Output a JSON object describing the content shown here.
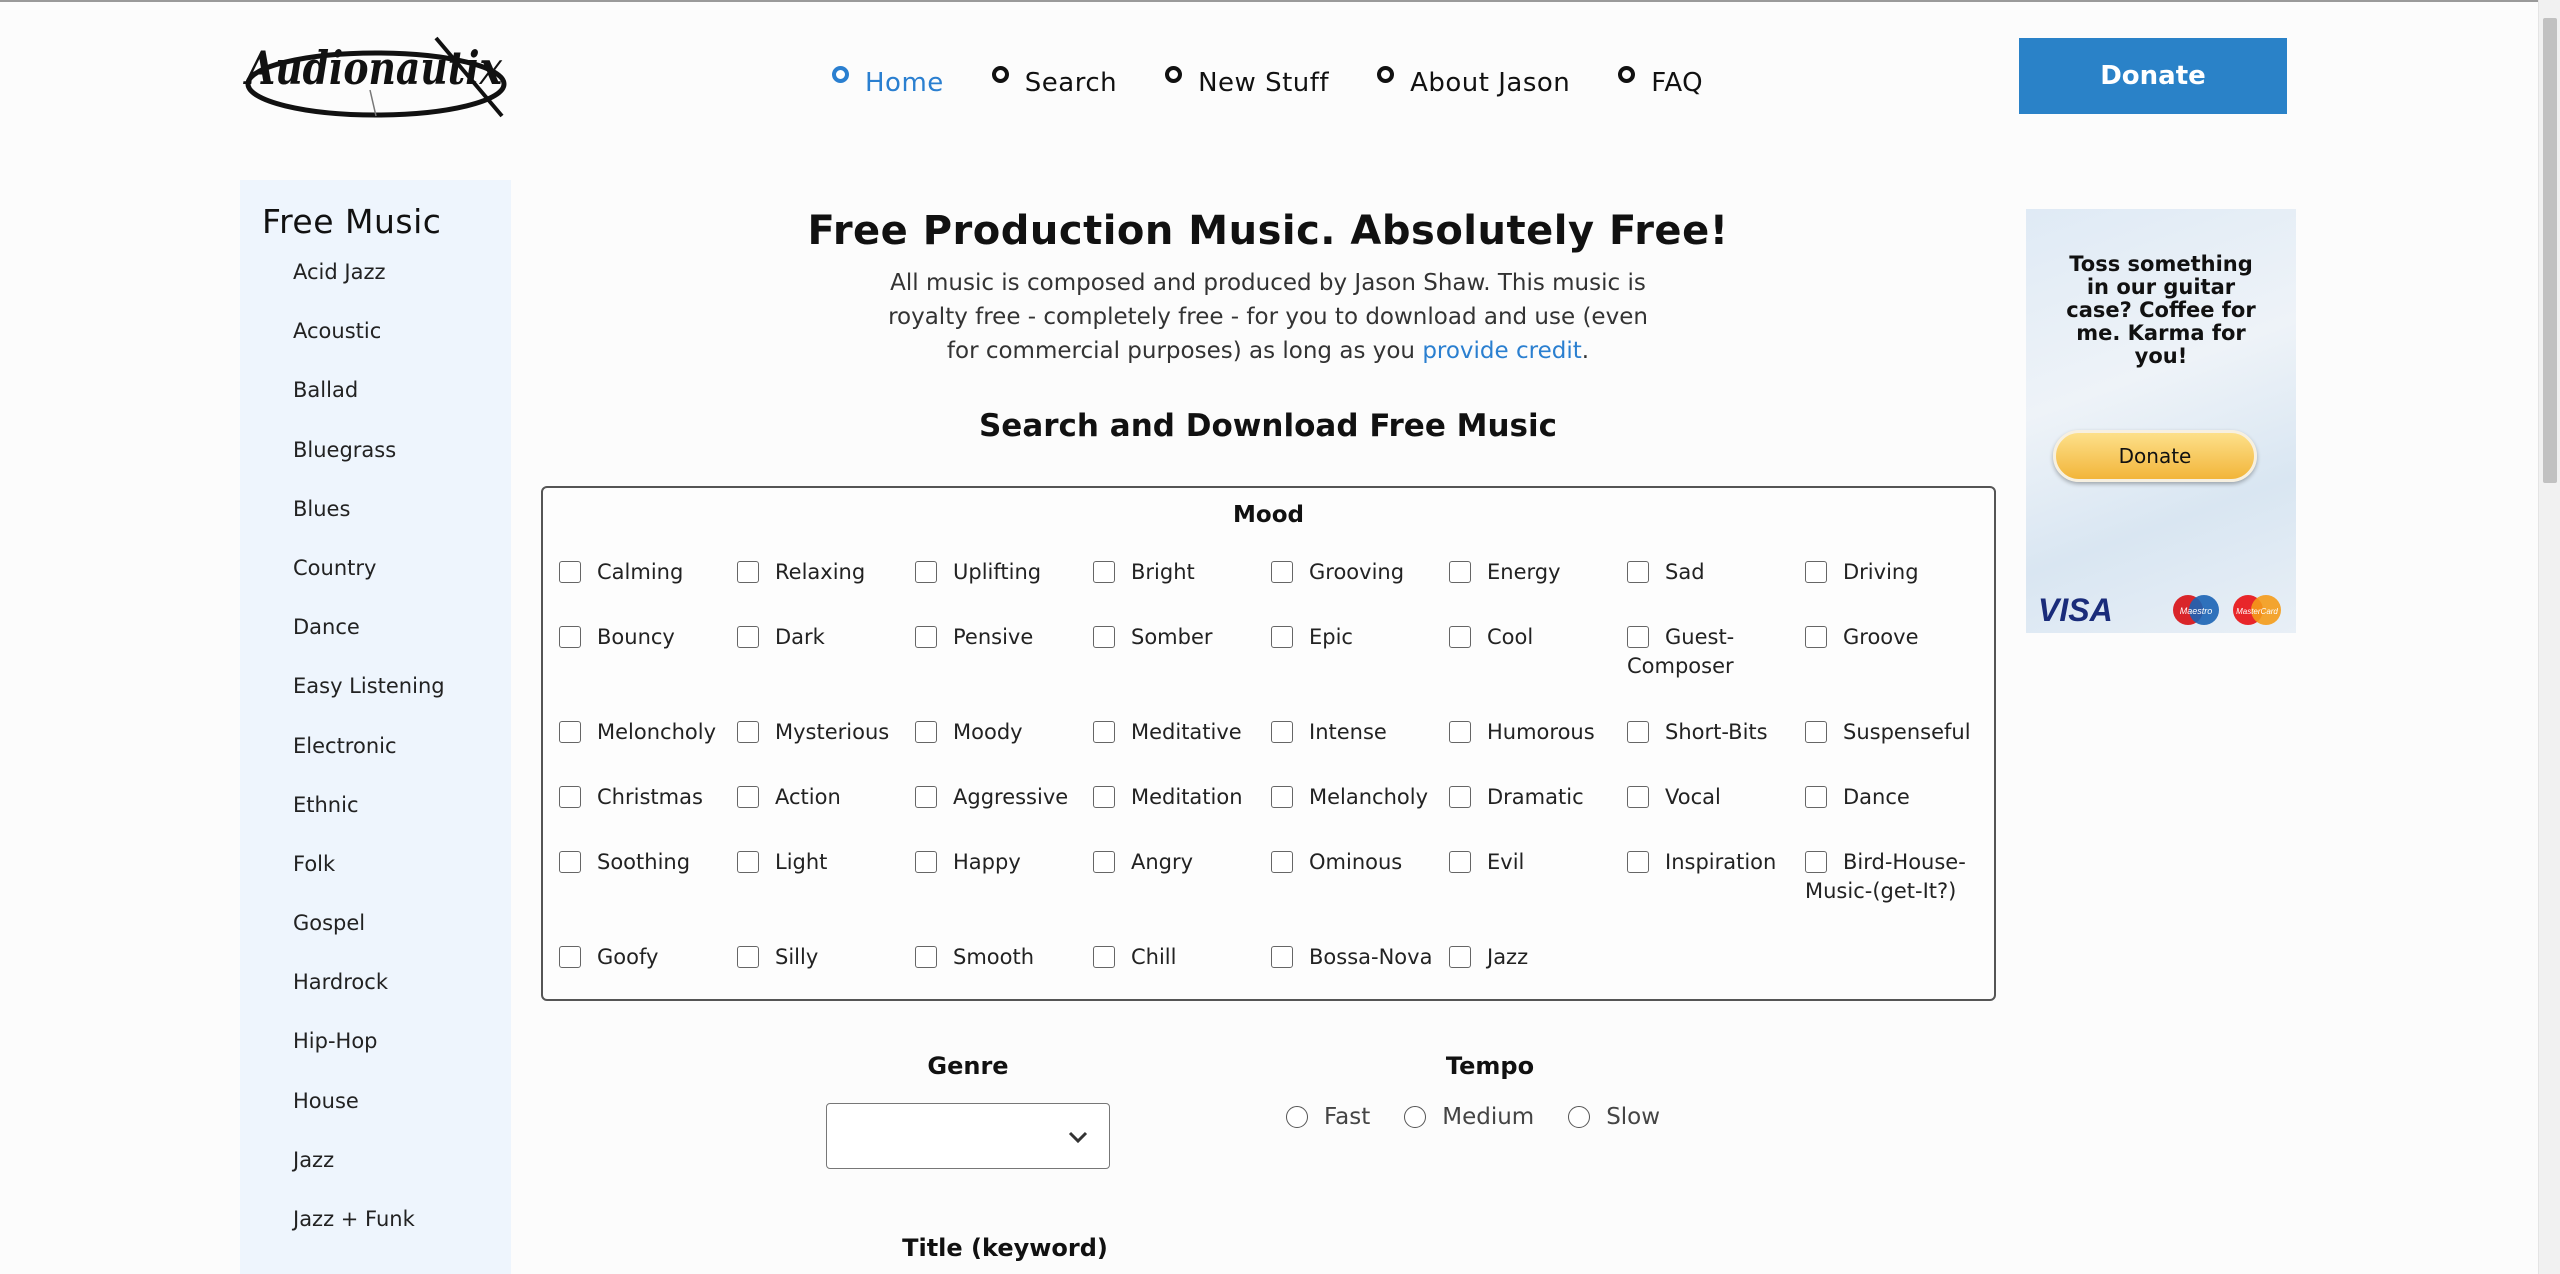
{
  "header": {
    "logo_text": "Audionautix",
    "nav": [
      {
        "label": "Home",
        "active": true
      },
      {
        "label": "Search",
        "active": false
      },
      {
        "label": "New Stuff",
        "active": false
      },
      {
        "label": "About Jason",
        "active": false
      },
      {
        "label": "FAQ",
        "active": false
      }
    ],
    "donate_label": "Donate"
  },
  "sidebar": {
    "title": "Free Music",
    "items": [
      "Acid Jazz",
      "Acoustic",
      "Ballad",
      "Bluegrass",
      "Blues",
      "Country",
      "Dance",
      "Easy Listening",
      "Electronic",
      "Ethnic",
      "Folk",
      "Gospel",
      "Hardrock",
      "Hip-Hop",
      "House",
      "Jazz",
      "Jazz + Funk"
    ]
  },
  "main": {
    "title": "Free Production Music. Absolutely Free!",
    "intro_text": "All music is composed and produced by Jason Shaw. This music is royalty free - completely free - for you to download and use (even for commercial purposes) as long as you",
    "intro_link": "provide credit",
    "intro_end": ".",
    "search_title": "Search and Download Free Music",
    "mood": {
      "legend": "Mood",
      "options": [
        "Calming",
        "Relaxing",
        "Uplifting",
        "Bright",
        "Grooving",
        "Energy",
        "Sad",
        "Driving",
        "Bouncy",
        "Dark",
        "Pensive",
        "Somber",
        "Epic",
        "Cool",
        "Guest-Composer",
        "Groove",
        "Meloncholy",
        "Mysterious",
        "Moody",
        "Meditative",
        "Intense",
        "Humorous",
        "Short-Bits",
        "Suspenseful",
        "Christmas",
        "Action",
        "Aggressive",
        "Meditation",
        "Melancholy",
        "Dramatic",
        "Vocal",
        "Dance",
        "Soothing",
        "Light",
        "Happy",
        "Angry",
        "Ominous",
        "Evil",
        "Inspiration",
        "Bird-House-Music-(get-It?)",
        "Goofy",
        "Silly",
        "Smooth",
        "Chill",
        "Bossa-Nova",
        "Jazz"
      ]
    },
    "genre_label": "Genre",
    "genre_selected": "",
    "tempo_label": "Tempo",
    "tempo_options": [
      "Fast",
      "Medium",
      "Slow"
    ],
    "keyword_label": "Title (keyword)"
  },
  "ad": {
    "text": "Toss something in our guitar case? Coffee for me. Karma for you!",
    "donate_label": "Donate",
    "cards": [
      "VISA",
      "Maestro",
      "MasterCard"
    ]
  },
  "colors": {
    "accent": "#2a7fd0",
    "donate_button": "#2a82c8",
    "sidebar_bg": "#eef5fd"
  }
}
